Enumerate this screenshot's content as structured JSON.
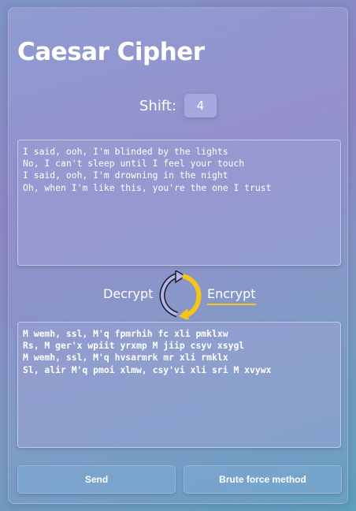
{
  "title": "Caesar Cipher",
  "shift": {
    "label": "Shift:",
    "value": "4"
  },
  "plaintext": "I said, ooh, I'm blinded by the lights\nNo, I can't sleep until I feel your touch\nI said, ooh, I'm drowning in the night\nOh, when I'm like this, you're the one I trust",
  "mode": {
    "decrypt_label": "Decrypt",
    "encrypt_label": "Encrypt",
    "selected": "Encrypt"
  },
  "ciphertext": "M wemh, ssl, M'q fpmrhih fc xli pmklxw\nRs, M ger'x wpiit yrxmp M jiip csyv xsygl\nM wemh, ssl, M'q hvsarmrk mr xli rmklx\nSl, alir M'q pmoi xlmw, csy'vi xli sri M xvywx",
  "buttons": {
    "send_label": "Send",
    "brute_label": "Brute force method"
  },
  "colors": {
    "accent": "#f5c518",
    "text": "#ffffff"
  },
  "icons": {
    "swap": "swap-arrows-icon"
  }
}
